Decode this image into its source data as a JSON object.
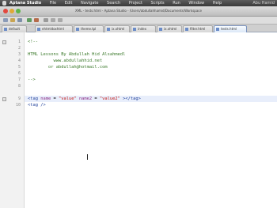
{
  "menubar": {
    "app": "Aptana Studio",
    "items": [
      "File",
      "Edit",
      "Navigate",
      "Search",
      "Project",
      "Scripts",
      "Run",
      "Window",
      "Help"
    ],
    "status": "Abu Hamid"
  },
  "window": {
    "title": "XML - tests.html - Aptana Studio - /Users/abdullahhamid/Documents/Workspace"
  },
  "tabs": [
    "default",
    "ehtmldoxhtml",
    "theme.tpl",
    "ix.xhtml",
    "index",
    "ix.xhtml",
    "filter.html",
    "tests.html"
  ],
  "editor": {
    "lines": [
      {
        "num": "1",
        "parts": [
          {
            "t": "<!--",
            "c": "comment"
          }
        ]
      },
      {
        "num": "2",
        "parts": []
      },
      {
        "num": "3",
        "parts": [
          {
            "t": "HTML Lessons By Abdullah Hid Alsahmedl",
            "c": "comment"
          }
        ]
      },
      {
        "num": "4",
        "parts": [
          {
            "t": "          www.abdullahhid.net",
            "c": "comment"
          }
        ]
      },
      {
        "num": "5",
        "parts": [
          {
            "t": "        or abdullah@hotmail.com",
            "c": "comment"
          }
        ]
      },
      {
        "num": "6",
        "parts": []
      },
      {
        "num": "7",
        "parts": [
          {
            "t": "-->",
            "c": "comment"
          }
        ]
      },
      {
        "num": "8",
        "parts": []
      },
      {
        "num": "9",
        "parts": [
          {
            "t": "<tag ",
            "c": "tag"
          },
          {
            "t": "name",
            "c": "attr"
          },
          {
            "t": " = ",
            "c": "plain"
          },
          {
            "t": "\"value\"",
            "c": "str"
          },
          {
            "t": " ",
            "c": "plain"
          },
          {
            "t": "name2",
            "c": "attr"
          },
          {
            "t": " = ",
            "c": "plain"
          },
          {
            "t": "\"value2\"",
            "c": "str"
          },
          {
            "t": " ></tag>",
            "c": "tag"
          }
        ]
      },
      {
        "num": "10",
        "parts": [
          {
            "t": "<tag />",
            "c": "tag"
          }
        ]
      }
    ]
  },
  "colors": {
    "close": "#e2483f",
    "minimize": "#e0a935",
    "zoom": "#5fb54a",
    "comment": "#3c7a2c",
    "tag": "#1f3f9a",
    "attribute": "#8b2a85",
    "string": "#c41a16"
  }
}
